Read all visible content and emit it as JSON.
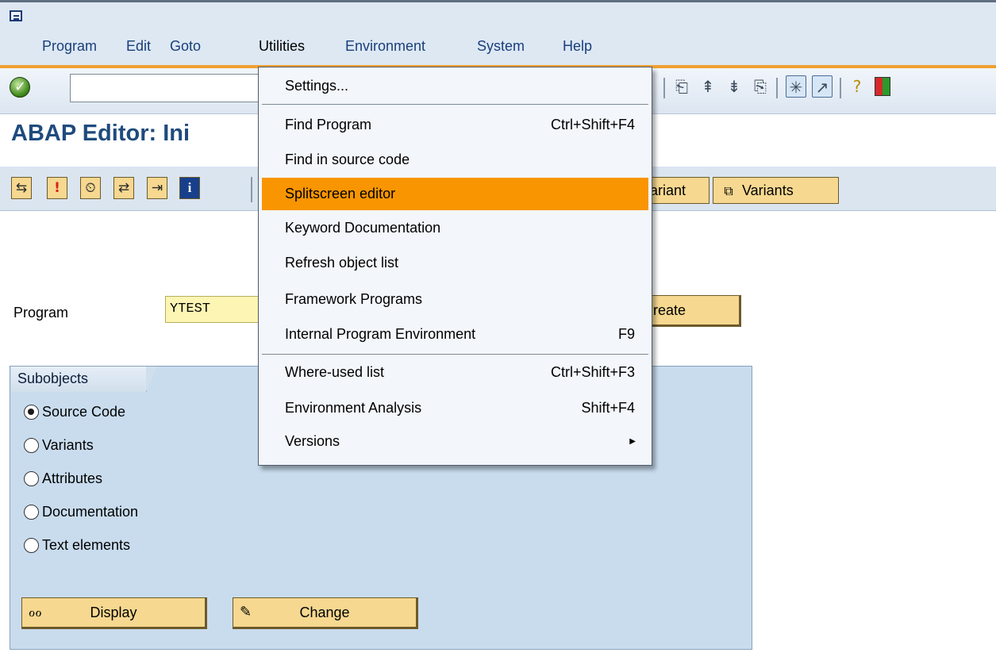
{
  "menubar": {
    "items": [
      {
        "label": "Program",
        "mnemonic": "P"
      },
      {
        "label": "Edit",
        "mnemonic": "E"
      },
      {
        "label": "Goto",
        "mnemonic": "G"
      },
      {
        "label": "Utilities",
        "mnemonic": ""
      },
      {
        "label": "Environment",
        "mnemonic": "v"
      },
      {
        "label": "System",
        "mnemonic": "y"
      },
      {
        "label": "Help",
        "mnemonic": "H"
      }
    ]
  },
  "std_toolbar": {
    "command_field_value": "",
    "icons": [
      "ok-check-icon",
      "first-page-icon",
      "previous-page-icon",
      "next-page-icon",
      "last-page-icon",
      "create-session-icon",
      "shortcut-icon",
      "help-icon",
      "customize-layout-icon"
    ]
  },
  "title": {
    "text": "ABAP Editor: Ini"
  },
  "app_toolbar": {
    "icons": [
      "other-object-icon",
      "check-icon",
      "activate-icon",
      "test-icon",
      "debugging-icon",
      "info-icon"
    ],
    "variant_label": "ariant",
    "variants_label": "Variants"
  },
  "program": {
    "label": "Program",
    "value": "YTEST",
    "create_label": "reate"
  },
  "subobjects": {
    "title": "Subobjects",
    "options": [
      {
        "label": "Source Code",
        "selected": true
      },
      {
        "label": "Variants",
        "selected": false
      },
      {
        "label": "Attributes",
        "selected": false
      },
      {
        "label": "Documentation",
        "selected": false
      },
      {
        "label": "Text elements",
        "selected": false
      }
    ],
    "display_label": "Display",
    "change_label": "Change"
  },
  "dropdown": {
    "menu": "Utilities",
    "items": [
      {
        "label": "Settings...",
        "shortcut": ""
      },
      {
        "label": "Find Program",
        "shortcut": "Ctrl+Shift+F4"
      },
      {
        "label": "Find in source code",
        "shortcut": ""
      },
      {
        "label": "Splitscreen editor",
        "shortcut": "",
        "highlighted": true
      },
      {
        "label": "Keyword Documentation",
        "shortcut": ""
      },
      {
        "label": "Refresh object list",
        "shortcut": ""
      },
      {
        "label": "Framework Programs",
        "shortcut": ""
      },
      {
        "label": "Internal Program Environment",
        "shortcut": "F9"
      },
      {
        "label": "Where-used list",
        "shortcut": "Ctrl+Shift+F3"
      },
      {
        "label": "Environment Analysis",
        "shortcut": "Shift+F4"
      },
      {
        "label": "Versions",
        "shortcut": "",
        "submenu": true
      }
    ]
  },
  "colors": {
    "menubar_bg": "#dde8f3",
    "accent_orange": "#f99500",
    "title_blue": "#1f4b7d",
    "button_gold": "#f6d890",
    "group_bg": "#c9dcee",
    "input_yellow": "#fdf5b4"
  }
}
